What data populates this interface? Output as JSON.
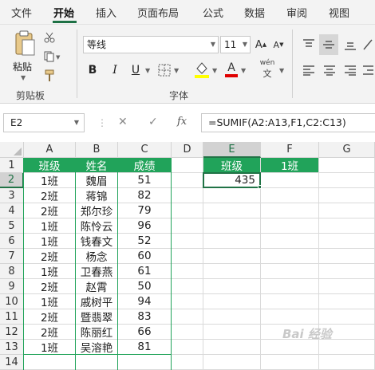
{
  "menu": {
    "tabs": [
      "文件",
      "开始",
      "插入",
      "页面布局",
      "公式",
      "数据",
      "审阅",
      "视图"
    ]
  },
  "ribbon": {
    "paste_label": "粘贴",
    "clipboard_label": "剪贴板",
    "font_name": "等线",
    "font_size": "11",
    "font_group_label": "字体",
    "bold": "B",
    "italic": "I",
    "underline": "U",
    "phonetic": "wén"
  },
  "formula_bar": {
    "name_box": "E2",
    "cancel": "✕",
    "enter": "✓",
    "fx": "fx",
    "formula": "=SUMIF(A2:A13,F1,C2:C13)"
  },
  "sheet": {
    "columns": [
      "A",
      "B",
      "C",
      "D",
      "E",
      "F",
      "G"
    ],
    "rows": [
      "1",
      "2",
      "3",
      "4",
      "5",
      "6",
      "7",
      "8",
      "9",
      "10",
      "11",
      "12",
      "13",
      "14"
    ],
    "header": [
      "班级",
      "姓名",
      "成绩"
    ],
    "data": [
      [
        "1班",
        "魏眉",
        "51"
      ],
      [
        "2班",
        "蒋锦",
        "82"
      ],
      [
        "2班",
        "郑尔珍",
        "79"
      ],
      [
        "1班",
        "陈怜云",
        "96"
      ],
      [
        "1班",
        "钱春文",
        "52"
      ],
      [
        "2班",
        "杨念",
        "60"
      ],
      [
        "1班",
        "卫春燕",
        "61"
      ],
      [
        "2班",
        "赵霄",
        "50"
      ],
      [
        "1班",
        "戚树平",
        "94"
      ],
      [
        "2班",
        "暨翡翠",
        "83"
      ],
      [
        "2班",
        "陈丽红",
        "66"
      ],
      [
        "1班",
        "吴溶艳",
        "81"
      ]
    ],
    "criteria_label": "班级",
    "criteria_value": "1班",
    "result": "435"
  },
  "colors": {
    "accent_green": "#217346",
    "header_fill": "#21a35a"
  },
  "watermark": "Bai 经验"
}
